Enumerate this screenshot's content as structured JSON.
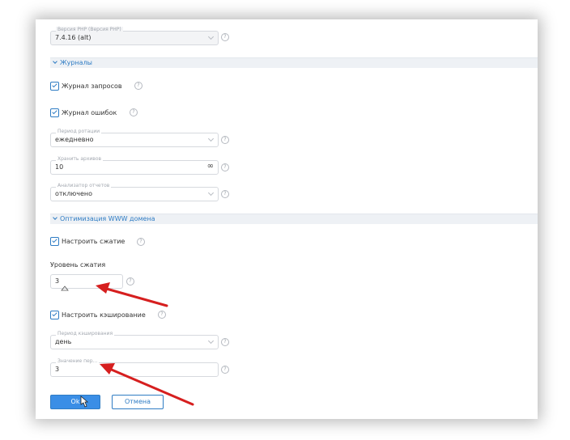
{
  "php": {
    "label": "Версия PHP (Версия PHP)",
    "value": "7.4.16 (alt)"
  },
  "logs_section": {
    "title": "Журналы"
  },
  "request_log": {
    "label": "Журнал запросов",
    "checked": true
  },
  "error_log": {
    "label": "Журнал ошибок",
    "checked": true
  },
  "rotation_period": {
    "label": "Период ротации",
    "value": "ежедневно"
  },
  "keep_archives": {
    "label": "Хранить архивов",
    "value": "10",
    "suffix": "∞"
  },
  "log_analyzer": {
    "label": "Анализатор отчетов",
    "value": "отключено"
  },
  "www_section": {
    "title": "Оптимизация WWW домена"
  },
  "compression": {
    "label": "Настроить сжатие",
    "checked": true
  },
  "compression_level": {
    "label": "Уровень сжатия",
    "value": "3"
  },
  "caching": {
    "label": "Настроить кэширование",
    "checked": true
  },
  "cache_period": {
    "label": "Период кэширования",
    "value": "день"
  },
  "period_value": {
    "label": "Значение пер...",
    "value": "3"
  },
  "help_glyph": "?",
  "actions": {
    "ok": "Ok",
    "cancel": "Отмена"
  },
  "colors": {
    "accent": "#2f7cc4",
    "annotation_arrow": "#d61f1f"
  }
}
